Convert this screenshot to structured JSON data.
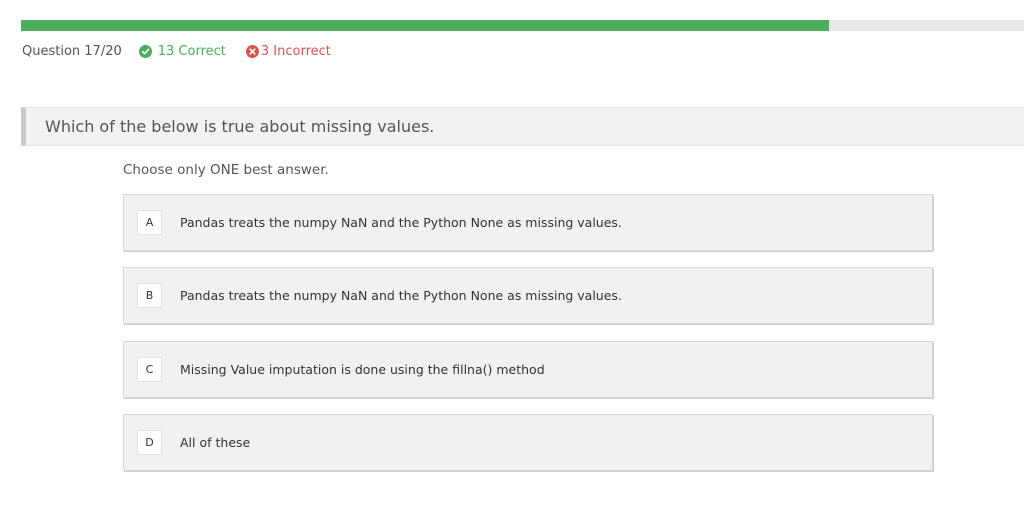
{
  "progress": {
    "percent": 80.6,
    "fill_color": "#4cae5c"
  },
  "stats": {
    "question_label": "Question 17/20",
    "correct_label": "13 Correct",
    "incorrect_label": "3 Incorrect",
    "correct_icon": "check-circle-icon",
    "incorrect_icon": "x-circle-icon",
    "correct_color": "#4cae5c",
    "incorrect_color": "#d9534f"
  },
  "question": {
    "text": "Which of the below is true about missing values.",
    "instruction": "Choose only ONE best answer."
  },
  "options": [
    {
      "letter": "A",
      "text": "Pandas treats the numpy NaN and the Python None as missing values."
    },
    {
      "letter": "B",
      "text": "Pandas treats the numpy NaN and the Python None as missing values."
    },
    {
      "letter": "C",
      "text": "Missing Value imputation is done using the fillna() method"
    },
    {
      "letter": "D",
      "text": "All of these"
    }
  ]
}
